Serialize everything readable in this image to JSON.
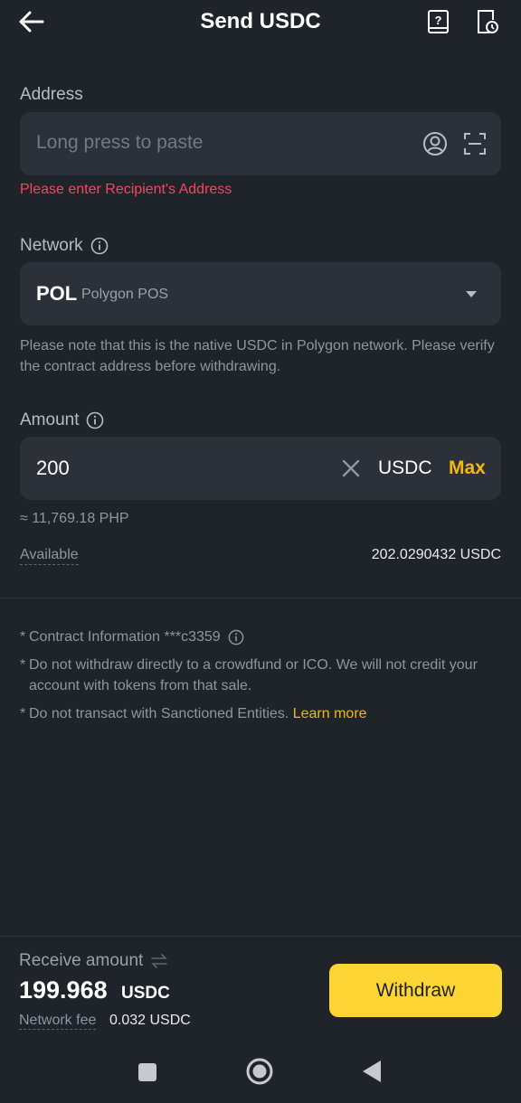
{
  "header": {
    "title": "Send USDC",
    "back_icon": "arrow-left-icon",
    "help_icon": "help-book-icon",
    "history_icon": "history-icon"
  },
  "address": {
    "label": "Address",
    "placeholder": "Long press to paste",
    "error": "Please enter Recipient's Address",
    "contact_icon": "contact-icon",
    "scan_icon": "scan-icon"
  },
  "network": {
    "label": "Network",
    "code": "POL",
    "name": "Polygon POS",
    "note": "Please note that this is the native USDC in Polygon network. Please verify the contract address before withdrawing."
  },
  "amount": {
    "label": "Amount",
    "value": "200",
    "unit": "USDC",
    "max_label": "Max",
    "fiat": "≈ 11,769.18 PHP",
    "available_label": "Available",
    "available_value": "202.0290432 USDC"
  },
  "info": {
    "contract": "Contract Information ***c3359",
    "warning1": "Do not withdraw directly to a crowdfund or ICO. We will not credit your account with tokens from that sale.",
    "warning2": "Do not transact with Sanctioned Entities.",
    "learn_more": "Learn more",
    "star": "*"
  },
  "footer": {
    "receive_label": "Receive amount",
    "receive_amount": "199.968",
    "receive_unit": "USDC",
    "fee_label": "Network fee",
    "fee_value": "0.032 USDC",
    "withdraw_label": "Withdraw"
  },
  "colors": {
    "background": "#1f232a",
    "field": "#2b3039",
    "accent": "#fcd535",
    "link": "#f0b90b",
    "error": "#f6465d"
  }
}
